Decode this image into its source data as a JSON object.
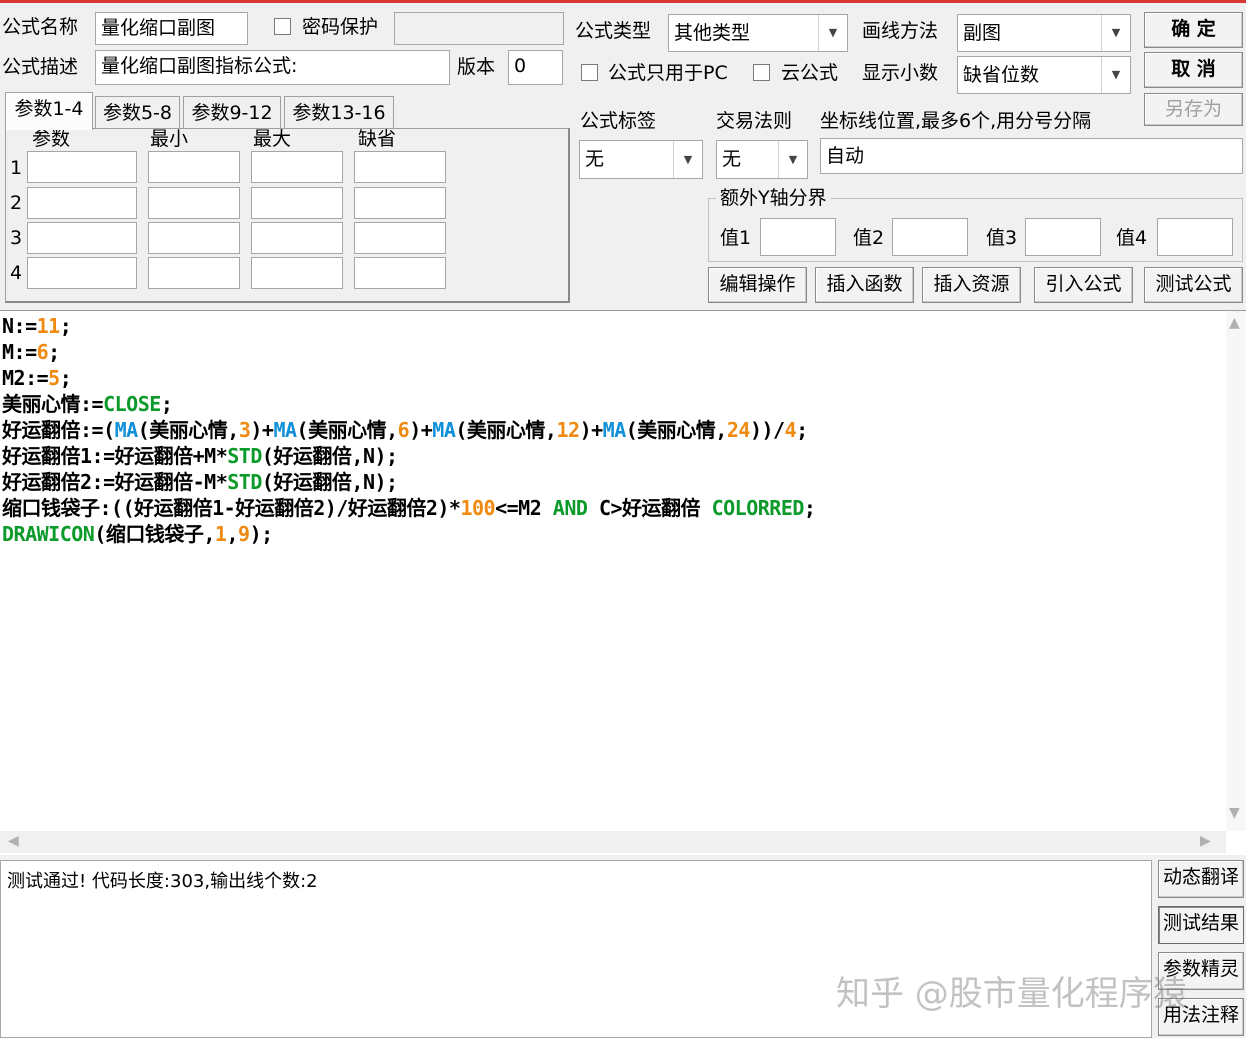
{
  "colors": {
    "window_bg": "#f0f0f0",
    "title_strip": "#d93636",
    "keyword_green": "#0c9a2a",
    "function_blue": "#1090d8",
    "number_orange": "#f08a10"
  },
  "header": {
    "name_label": "公式名称",
    "name_value": "量化缩口副图",
    "password_label": "密码保护",
    "password_checked": false,
    "desc_label": "公式描述",
    "desc_value": "量化缩口副图指标公式:",
    "version_label": "版本",
    "version_value": "0",
    "type_label": "公式类型",
    "type_value": "其他类型",
    "draw_label": "画线方法",
    "draw_value": "副图",
    "pc_only_label": "公式只用于PC",
    "cloud_label": "云公式",
    "decimals_label": "显示小数",
    "decimals_value": "缺省位数",
    "ok_button": "确  定",
    "cancel_button": "取  消",
    "save_as_button": "另存为"
  },
  "tabs": [
    "参数1-4",
    "参数5-8",
    "参数9-12",
    "参数13-16"
  ],
  "params": {
    "columns": [
      "参数",
      "最小",
      "最大",
      "缺省"
    ],
    "rows": [
      "1",
      "2",
      "3",
      "4"
    ]
  },
  "options": {
    "tag_label": "公式标签",
    "tag_value": "无",
    "rule_label": "交易法则",
    "rule_value": "无",
    "axis_label": "坐标线位置,最多6个,用分号分隔",
    "axis_value": "自动",
    "extra_y_label": "额外Y轴分界",
    "value_labels": [
      "值1",
      "值2",
      "值3",
      "值4"
    ]
  },
  "action_buttons": [
    "编辑操作",
    "插入函数",
    "插入资源",
    "引入公式",
    "测试公式"
  ],
  "code": {
    "line1": [
      "N:=",
      "11",
      ";"
    ],
    "line2": [
      "M:=",
      "6",
      ";"
    ],
    "line3": [
      "M2:=",
      "5",
      ";"
    ],
    "line4": [
      "美丽心情:=",
      "CLOSE",
      ";"
    ],
    "line5": [
      "好运翻倍:=(",
      "MA",
      "(美丽心情,",
      "3",
      ")+",
      "MA",
      "(美丽心情,",
      "6",
      ")+",
      "MA",
      "(美丽心情,",
      "12",
      ")+",
      "MA",
      "(美丽心情,",
      "24",
      "))/",
      "4",
      ";"
    ],
    "line6": [
      "好运翻倍1:=好运翻倍+M*",
      "STD",
      "(好运翻倍,N);"
    ],
    "line7": [
      "好运翻倍2:=好运翻倍-M*",
      "STD",
      "(好运翻倍,N);"
    ],
    "line8": [
      "缩口钱袋子:((好运翻倍1-好运翻倍2)/好运翻倍2)*",
      "100",
      "<=M2 ",
      "AND",
      " C>好运翻倍 ",
      "COLORRED",
      ";"
    ],
    "line9": [
      "DRAWICON",
      "(缩口钱袋子,",
      "1",
      ",",
      "9",
      ");"
    ]
  },
  "status": {
    "message": "测试通过! 代码长度:303,输出线个数:2"
  },
  "side_buttons": [
    "动态翻译",
    "测试结果",
    "参数精灵",
    "用法注释"
  ],
  "watermark": "知乎 @股市量化程序猿"
}
